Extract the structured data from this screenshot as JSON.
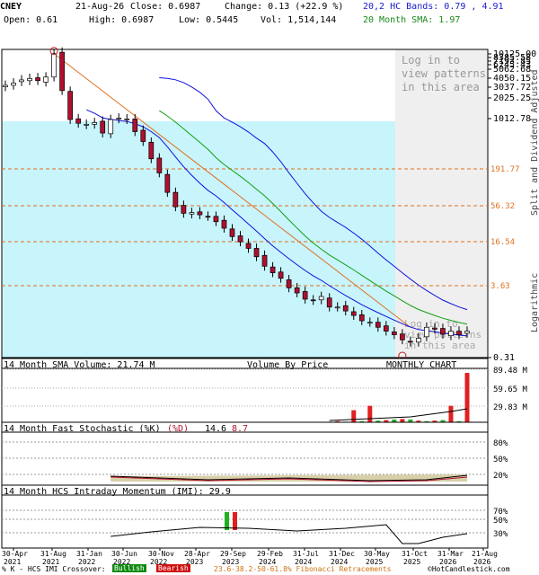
{
  "header": {
    "symbol": "CNEY",
    "date": "21-Aug-26",
    "close": "Close: 0.6987",
    "change": "Change: 0.13 (+22.9 %)",
    "open": "Open: 0.61",
    "high": "High: 0.6987",
    "low": "Low: 0.5445",
    "vol": "Vol: 1,514,144",
    "bands": "20,2 HC Bands: 0.79 , 4.91",
    "sma": "20 Month SMA: 1.97"
  },
  "colors": {
    "up": "#ffffff",
    "down": "#b01030",
    "bandBlue": "#1010e0",
    "smaGreen": "#10a010",
    "cyan": "#c8f4fc",
    "fib": "#e07020"
  },
  "main": {
    "y_labels": [
      "10125.00",
      "8385.58",
      "7193.85",
      "6245.43",
      "5062.68",
      "4050.15",
      "3037.72",
      "2025.25",
      "1012.78",
      "0.31"
    ],
    "fib_labels": [
      "191.77",
      "56.32",
      "16.54",
      "3.63"
    ],
    "watermark": [
      "Log in to",
      "view patterns",
      "in this area"
    ],
    "watermark2": [
      "Log in to",
      "view patterns",
      "in this area"
    ],
    "right_label": "Split and Dividend Adjusted",
    "log_label": "Logarithmic",
    "sma_volume": "14 Month SMA Volume: 21.74 M",
    "vbp": "Volume By Price",
    "monthly": "MONTHLY CHART"
  },
  "volume": {
    "labels": [
      "89.48 M",
      "59.65 M",
      "29.83 M"
    ]
  },
  "stoch": {
    "title": "14 Month Fast Stochastic (%K)",
    "title2": "(%D)",
    "k": "14.6",
    "d": "8.7",
    "labels": [
      "80%",
      "50%",
      "20%"
    ]
  },
  "imi": {
    "title": "14 Month HCS Intraday Momentum (IMI): 29.9",
    "labels": [
      "70%",
      "50%",
      "30%"
    ]
  },
  "x_labels": [
    [
      "30-Apr",
      "2021"
    ],
    [
      "31-Aug",
      "2021"
    ],
    [
      "31-Jan",
      "2022"
    ],
    [
      "30-Jun",
      "2022"
    ],
    [
      "30-Nov",
      "2022"
    ],
    [
      "28-Apr",
      "2023"
    ],
    [
      "29-Sep",
      "2023"
    ],
    [
      "29-Feb",
      "2024"
    ],
    [
      "31-Jul",
      "2024"
    ],
    [
      "31-Dec",
      "2024"
    ],
    [
      "30-May",
      "2025"
    ],
    [
      "31-Oct",
      "2025"
    ],
    [
      "31-Mar",
      "2026"
    ],
    [
      "21-Aug",
      "2026"
    ]
  ],
  "footer": {
    "a": "% K - HCS IMI Crossover:",
    "bull": "Bullish",
    "bear": "Bearish",
    "fib": "23.6-38.2-50-61.8% Fibonacci Retracements",
    "copy": "©HotCandlestick.com"
  },
  "chart_data": {
    "type": "candlestick",
    "scale": "log",
    "ylim": [
      0.31,
      10125
    ],
    "close_values": [
      3240,
      3500,
      3900,
      4100,
      3800,
      4300,
      9600,
      2700,
      1000,
      880,
      850,
      900,
      630,
      1000,
      1050,
      1020,
      660,
      470,
      260,
      160,
      82,
      50,
      40,
      41,
      38,
      36,
      30,
      24,
      18,
      15,
      12,
      9,
      6.5,
      5.2,
      4.3,
      3.1,
      2.6,
      2.1,
      2.0,
      2.3,
      1.6,
      1.6,
      1.4,
      1.2,
      1.0,
      0.95,
      0.8,
      0.7,
      0.62,
      0.52,
      0.48,
      0.55,
      0.8,
      0.75,
      0.63,
      0.7,
      0.62,
      0.7
    ],
    "volume_m": [
      0.2,
      0.2,
      0.2,
      0.2,
      0.2,
      0.2,
      0.3,
      0.2,
      0.2,
      0.2,
      0.2,
      0.2,
      0.2,
      0.2,
      0.2,
      0.2,
      0.2,
      0.2,
      0.2,
      0.2,
      0.2,
      0.2,
      0.2,
      0.3,
      0.3,
      0.3,
      0.3,
      0.3,
      0.3,
      0.3,
      0.3,
      0.3,
      0.3,
      0.3,
      0.3,
      0.3,
      0.3,
      0.3,
      0.3,
      0.3,
      1,
      2,
      1,
      22,
      2,
      30,
      3,
      4,
      5,
      6,
      5,
      3,
      2,
      3,
      4,
      30,
      2,
      90,
      8,
      2
    ],
    "stochastic_pct": {
      "k_last": 14.6,
      "d_last": 8.7
    },
    "imi_pct": {
      "last": 29.9
    }
  }
}
